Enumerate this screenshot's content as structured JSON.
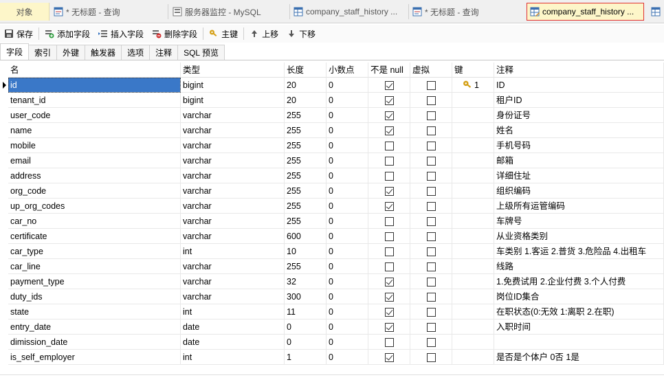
{
  "tabs": [
    {
      "label": "对象",
      "icon": "none",
      "active": false
    },
    {
      "label": "* 无标题 - 查询",
      "icon": "query-icon",
      "active": false
    },
    {
      "label": "服务器监控 - MySQL",
      "icon": "server-monitor-icon",
      "active": false
    },
    {
      "label": "company_staff_history ...",
      "icon": "table-icon",
      "active": false
    },
    {
      "label": "* 无标题 - 查询",
      "icon": "query-icon",
      "active": false
    },
    {
      "label": "company_staff_history ...",
      "icon": "table-design-icon",
      "active": true
    },
    {
      "label": "",
      "icon": "table-icon",
      "active": false
    }
  ],
  "toolbar": {
    "save": "保存",
    "add_field": "添加字段",
    "insert_field": "插入字段",
    "delete_field": "删除字段",
    "primary_key": "主键",
    "move_up": "上移",
    "move_down": "下移"
  },
  "subtabs": [
    "字段",
    "索引",
    "外键",
    "触发器",
    "选项",
    "注释",
    "SQL 预览"
  ],
  "columns": [
    "名",
    "类型",
    "长度",
    "小数点",
    "不是 null",
    "虚拟",
    "键",
    "注释"
  ],
  "fields": [
    {
      "name": "id",
      "type": "bigint",
      "length": "20",
      "decimals": "0",
      "not_null": true,
      "virtual": false,
      "key": "1",
      "comment": "ID"
    },
    {
      "name": "tenant_id",
      "type": "bigint",
      "length": "20",
      "decimals": "0",
      "not_null": true,
      "virtual": false,
      "key": "",
      "comment": "租户ID"
    },
    {
      "name": "user_code",
      "type": "varchar",
      "length": "255",
      "decimals": "0",
      "not_null": true,
      "virtual": false,
      "key": "",
      "comment": "身份证号"
    },
    {
      "name": "name",
      "type": "varchar",
      "length": "255",
      "decimals": "0",
      "not_null": true,
      "virtual": false,
      "key": "",
      "comment": "姓名"
    },
    {
      "name": "mobile",
      "type": "varchar",
      "length": "255",
      "decimals": "0",
      "not_null": false,
      "virtual": false,
      "key": "",
      "comment": "手机号码"
    },
    {
      "name": "email",
      "type": "varchar",
      "length": "255",
      "decimals": "0",
      "not_null": false,
      "virtual": false,
      "key": "",
      "comment": "邮箱"
    },
    {
      "name": "address",
      "type": "varchar",
      "length": "255",
      "decimals": "0",
      "not_null": false,
      "virtual": false,
      "key": "",
      "comment": "详细住址"
    },
    {
      "name": "org_code",
      "type": "varchar",
      "length": "255",
      "decimals": "0",
      "not_null": true,
      "virtual": false,
      "key": "",
      "comment": "组织编码"
    },
    {
      "name": "up_org_codes",
      "type": "varchar",
      "length": "255",
      "decimals": "0",
      "not_null": true,
      "virtual": false,
      "key": "",
      "comment": "上级所有运管编码"
    },
    {
      "name": "car_no",
      "type": "varchar",
      "length": "255",
      "decimals": "0",
      "not_null": false,
      "virtual": false,
      "key": "",
      "comment": "车牌号"
    },
    {
      "name": "certificate",
      "type": "varchar",
      "length": "600",
      "decimals": "0",
      "not_null": false,
      "virtual": false,
      "key": "",
      "comment": "从业资格类别"
    },
    {
      "name": "car_type",
      "type": "int",
      "length": "10",
      "decimals": "0",
      "not_null": false,
      "virtual": false,
      "key": "",
      "comment": "车类别 1.客运  2.普货  3.危险品  4.出租车"
    },
    {
      "name": "car_line",
      "type": "varchar",
      "length": "255",
      "decimals": "0",
      "not_null": false,
      "virtual": false,
      "key": "",
      "comment": "线路"
    },
    {
      "name": "payment_type",
      "type": "varchar",
      "length": "32",
      "decimals": "0",
      "not_null": true,
      "virtual": false,
      "key": "",
      "comment": "1.免费试用 2.企业付费 3.个人付费"
    },
    {
      "name": "duty_ids",
      "type": "varchar",
      "length": "300",
      "decimals": "0",
      "not_null": true,
      "virtual": false,
      "key": "",
      "comment": "岗位ID集合"
    },
    {
      "name": "state",
      "type": "int",
      "length": "11",
      "decimals": "0",
      "not_null": true,
      "virtual": false,
      "key": "",
      "comment": "在职状态(0:无效 1:离职 2.在职)"
    },
    {
      "name": "entry_date",
      "type": "date",
      "length": "0",
      "decimals": "0",
      "not_null": true,
      "virtual": false,
      "key": "",
      "comment": "入职时间"
    },
    {
      "name": "dimission_date",
      "type": "date",
      "length": "0",
      "decimals": "0",
      "not_null": false,
      "virtual": false,
      "key": "",
      "comment": ""
    },
    {
      "name": "is_self_employer",
      "type": "int",
      "length": "1",
      "decimals": "0",
      "not_null": true,
      "virtual": false,
      "key": "",
      "comment": "是否是个体户 0否 1是"
    }
  ],
  "colors": {
    "active_tab": "#fdf6c9",
    "active_tab_border": "#e03030",
    "selection": "#3a78c8",
    "key_icon": "#d4a017"
  }
}
